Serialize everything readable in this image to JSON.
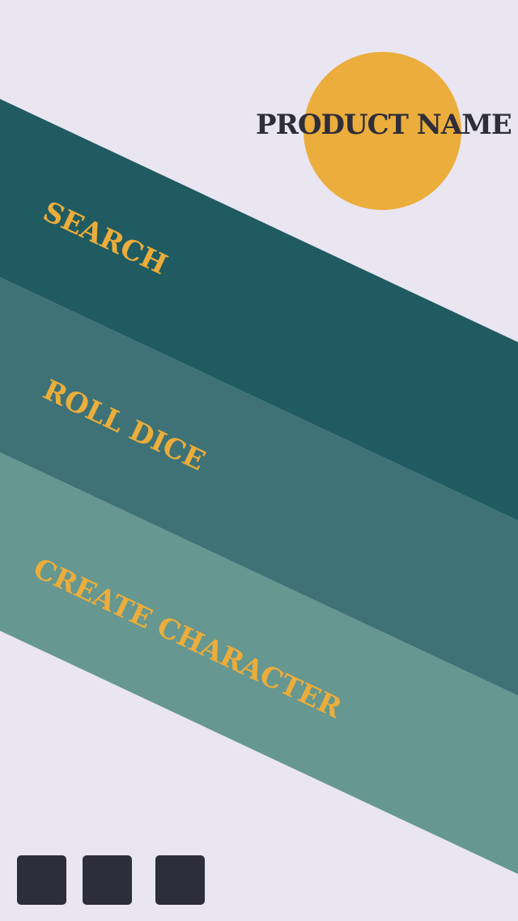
{
  "app": {
    "product_name": "PRODUCT NAME"
  },
  "menu": {
    "items": [
      {
        "label": "SEARCH"
      },
      {
        "label": "ROLL DICE"
      },
      {
        "label": "CREATE CHARACTER"
      }
    ]
  },
  "colors": {
    "background": "#e9e6f1",
    "accent_gold": "#ebad3b",
    "dark": "#2e2d3a",
    "band_search": "#205b61",
    "band_roll_dice": "#3e7276",
    "band_create_character": "#669790"
  }
}
